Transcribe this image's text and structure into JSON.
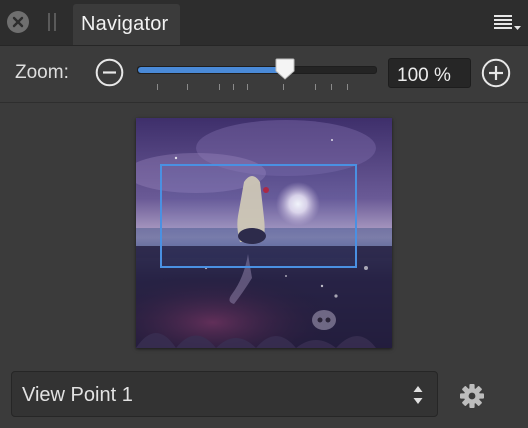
{
  "header": {
    "tab_label": "Navigator"
  },
  "zoom": {
    "label": "Zoom:",
    "value": "100 %",
    "slider_fraction": 0.62
  },
  "viewpoint": {
    "selected": "View Point 1"
  },
  "icons": {
    "close": "close-icon",
    "menu": "panel-menu-icon",
    "zoom_out": "minus-circle-icon",
    "zoom_in": "plus-circle-icon",
    "stepper": "up-down-arrows-icon",
    "settings": "gear-icon"
  },
  "colors": {
    "accent": "#4a8ad8",
    "viewport_frame": "#4a90e2",
    "panel_bg": "#3b3b3b",
    "header_bg": "#2d2d2d"
  }
}
